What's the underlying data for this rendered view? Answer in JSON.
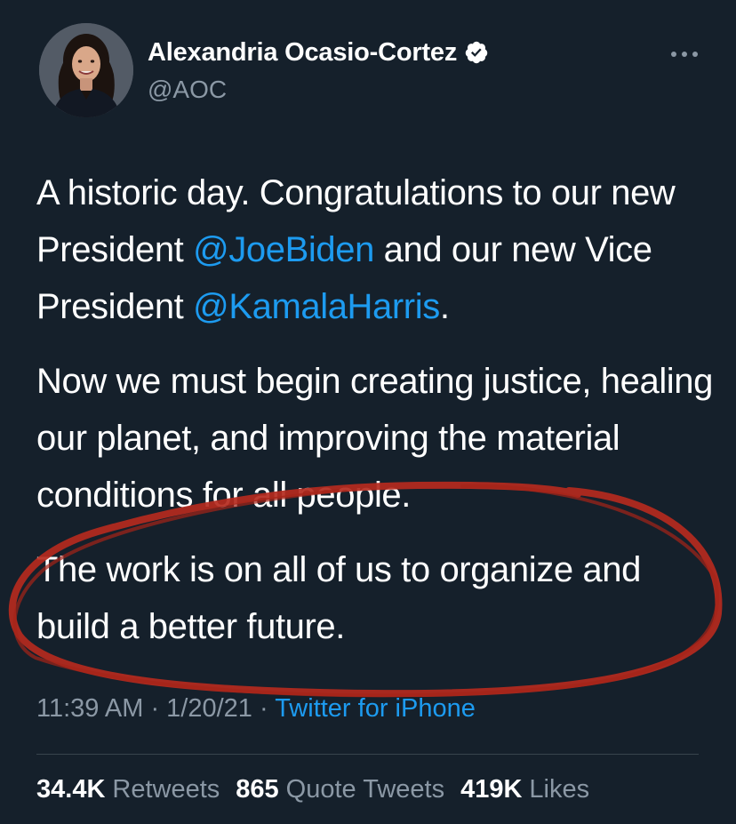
{
  "author": {
    "display_name": "Alexandria Ocasio-Cortez",
    "handle": "@AOC",
    "verified_icon": "verified-badge-icon",
    "avatar": "profile-photo"
  },
  "tweet": {
    "p1_a": "A historic day. Congratulations to our new President ",
    "mention_1": "@JoeBiden",
    "p1_b": " and our new Vice President ",
    "mention_2": "@KamalaHarris",
    "p1_c": ".",
    "p2": "Now we must begin creating justice, healing our planet, and improving the material conditions for all people.",
    "p3": "The work is on all of us to organize and build a better future."
  },
  "meta": {
    "time": "11:39 AM",
    "sep1": " · ",
    "date": "1/20/21",
    "sep2": " · ",
    "source": "Twitter for iPhone"
  },
  "stats": {
    "retweets_count": "34.4K",
    "retweets_label": "Retweets",
    "quotes_count": "865",
    "quotes_label": "Quote Tweets",
    "likes_count": "419K",
    "likes_label": "Likes"
  },
  "colors": {
    "background": "#15202b",
    "link": "#1d9bf0",
    "secondary_text": "#8b98a5",
    "annotation_circle": "#b52a1e"
  },
  "icons": {
    "more": "more-horizontal-icon"
  }
}
